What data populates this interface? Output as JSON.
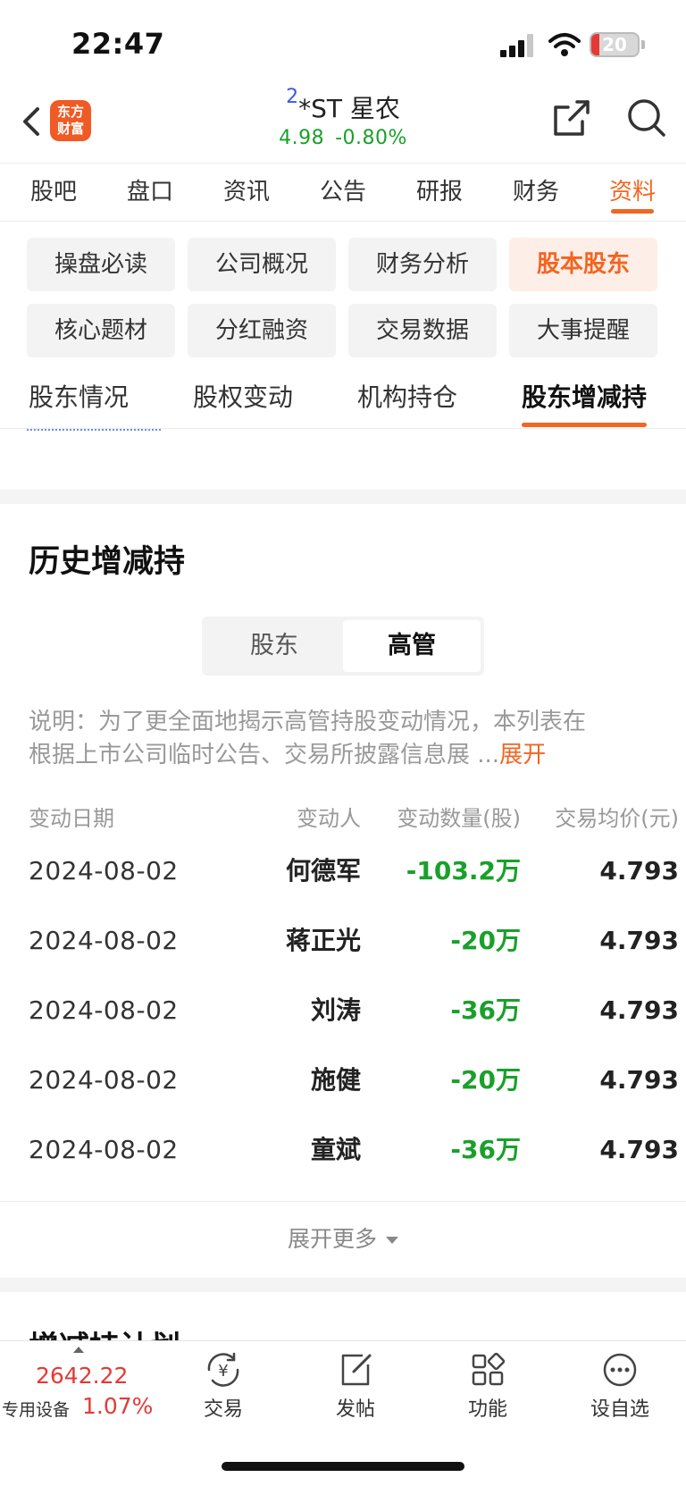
{
  "status_bar": {
    "time": "22:47",
    "battery": "20"
  },
  "header": {
    "badge": "2",
    "title": "*ST 星农",
    "price": "4.98",
    "change": "-0.80%",
    "logo_line1": "东方",
    "logo_line2": "财富"
  },
  "main_tabs": [
    "股吧",
    "盘口",
    "资讯",
    "公告",
    "研报",
    "财务",
    "资料"
  ],
  "main_tab_active": "资料",
  "categories": [
    "操盘必读",
    "公司概况",
    "财务分析",
    "股本股东",
    "核心题材",
    "分红融资",
    "交易数据",
    "大事提醒"
  ],
  "category_active": "股本股东",
  "sub_tabs": [
    "股东情况",
    "股权变动",
    "机构持仓",
    "股东增减持"
  ],
  "sub_tab_active": "股东增减持",
  "history": {
    "title": "历史增减持",
    "segments": [
      "股东",
      "高管"
    ],
    "segment_active": "高管",
    "desc_line1": "说明：为了更全面地揭示高管持股变动情况，本列表在",
    "desc_line2": "根据上市公司临时公告、交易所披露信息展 ...",
    "desc_more": "展开",
    "columns": [
      "变动日期",
      "变动人",
      "变动数量(股)",
      "交易均价(元)"
    ],
    "rows": [
      {
        "date": "2024-08-02",
        "person": "何德军",
        "qty": "-103.2万",
        "price": "4.793"
      },
      {
        "date": "2024-08-02",
        "person": "蒋正光",
        "qty": "-20万",
        "price": "4.793"
      },
      {
        "date": "2024-08-02",
        "person": "刘涛",
        "qty": "-36万",
        "price": "4.793"
      },
      {
        "date": "2024-08-02",
        "person": "施健",
        "qty": "-20万",
        "price": "4.793"
      },
      {
        "date": "2024-08-02",
        "person": "童斌",
        "qty": "-36万",
        "price": "4.793"
      }
    ],
    "expand_label": "展开更多"
  },
  "next_section_title": "增减持计划",
  "bottom_bar": {
    "index_value": "2642.22",
    "index_name": "专用设备",
    "index_change": "1.07%",
    "nav": [
      {
        "label": "交易",
        "icon": "yen-exchange-icon"
      },
      {
        "label": "发帖",
        "icon": "edit-post-icon"
      },
      {
        "label": "功能",
        "icon": "grid-apps-icon"
      },
      {
        "label": "设自选",
        "icon": "more-dots-icon"
      }
    ]
  },
  "colors": {
    "accent": "#f26522",
    "down": "#1aa02a",
    "up": "#e53935"
  }
}
